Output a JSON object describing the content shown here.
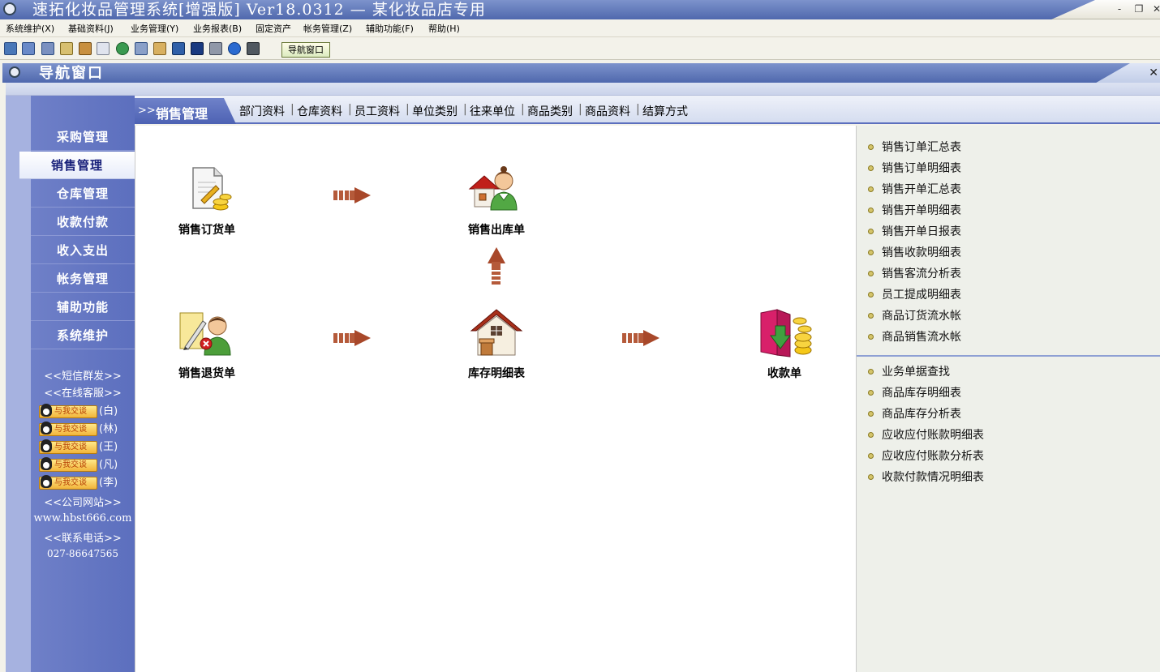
{
  "window": {
    "title": "速拓化妆品管理系统[增强版] Ver18.0312 — 某化妆品店专用",
    "minimize": "-",
    "restore": "❐",
    "close": "✕"
  },
  "menu": [
    "系统维护(X)",
    "基础资料(J)",
    "业务管理(Y)",
    "业务报表(B)",
    "固定资产",
    "帐务管理(Z)",
    "辅助功能(F)",
    "帮助(H)"
  ],
  "toolbar": {
    "nav_button": "导航窗口",
    "icons": [
      "list-icon",
      "list2-icon",
      "window-icon",
      "printer-preview-icon",
      "report-icon",
      "refresh-icon",
      "users-icon",
      "copy-icon",
      "edit-icon",
      "monitor-icon",
      "save-icon",
      "print-icon",
      "help-icon",
      "exit-icon"
    ]
  },
  "nav_window": {
    "title": "导航窗口",
    "close": "✕"
  },
  "sidebar": {
    "items": [
      {
        "label": "采购管理",
        "active": false
      },
      {
        "label": "销售管理",
        "active": true
      },
      {
        "label": "仓库管理",
        "active": false
      },
      {
        "label": "收款付款",
        "active": false
      },
      {
        "label": "收入支出",
        "active": false
      },
      {
        "label": "帐务管理",
        "active": false
      },
      {
        "label": "辅助功能",
        "active": false
      },
      {
        "label": "系统维护",
        "active": false
      }
    ],
    "sms": "<<短信群发>>",
    "online_service": "<<在线客服>>",
    "qq_badge": "与我交谈",
    "qq_agents": [
      "(白)",
      "(林)",
      "(王)",
      "(凡)",
      "(李)"
    ],
    "website_label": "<<公司网站>>",
    "website": "www.hbst666.com",
    "phone_label": "<<联系电话>>",
    "phone": "027-86647565"
  },
  "subnav": {
    "arrow": ">>",
    "current": "销售管理",
    "links": [
      "部门资料",
      "仓库资料",
      "员工资料",
      "单位类别",
      "往来单位",
      "商品类别",
      "商品资料",
      "结算方式"
    ]
  },
  "flow": {
    "sales_order": "销售订货单",
    "sales_outbound": "销售出库单",
    "sales_return": "销售退货单",
    "inventory_detail": "库存明细表",
    "receipt": "收款单"
  },
  "reports": {
    "group1": [
      "销售订单汇总表",
      "销售订单明细表",
      "销售开单汇总表",
      "销售开单明细表",
      "销售开单日报表",
      "销售收款明细表",
      "销售客流分析表",
      "员工提成明细表",
      "商品订货流水帐",
      "商品销售流水帐"
    ],
    "group2": [
      "业务单据查找",
      "商品库存明细表",
      "商品库存分析表",
      "应收应付账款明细表",
      "应收应付账款分析表",
      "收款付款情况明细表"
    ]
  }
}
